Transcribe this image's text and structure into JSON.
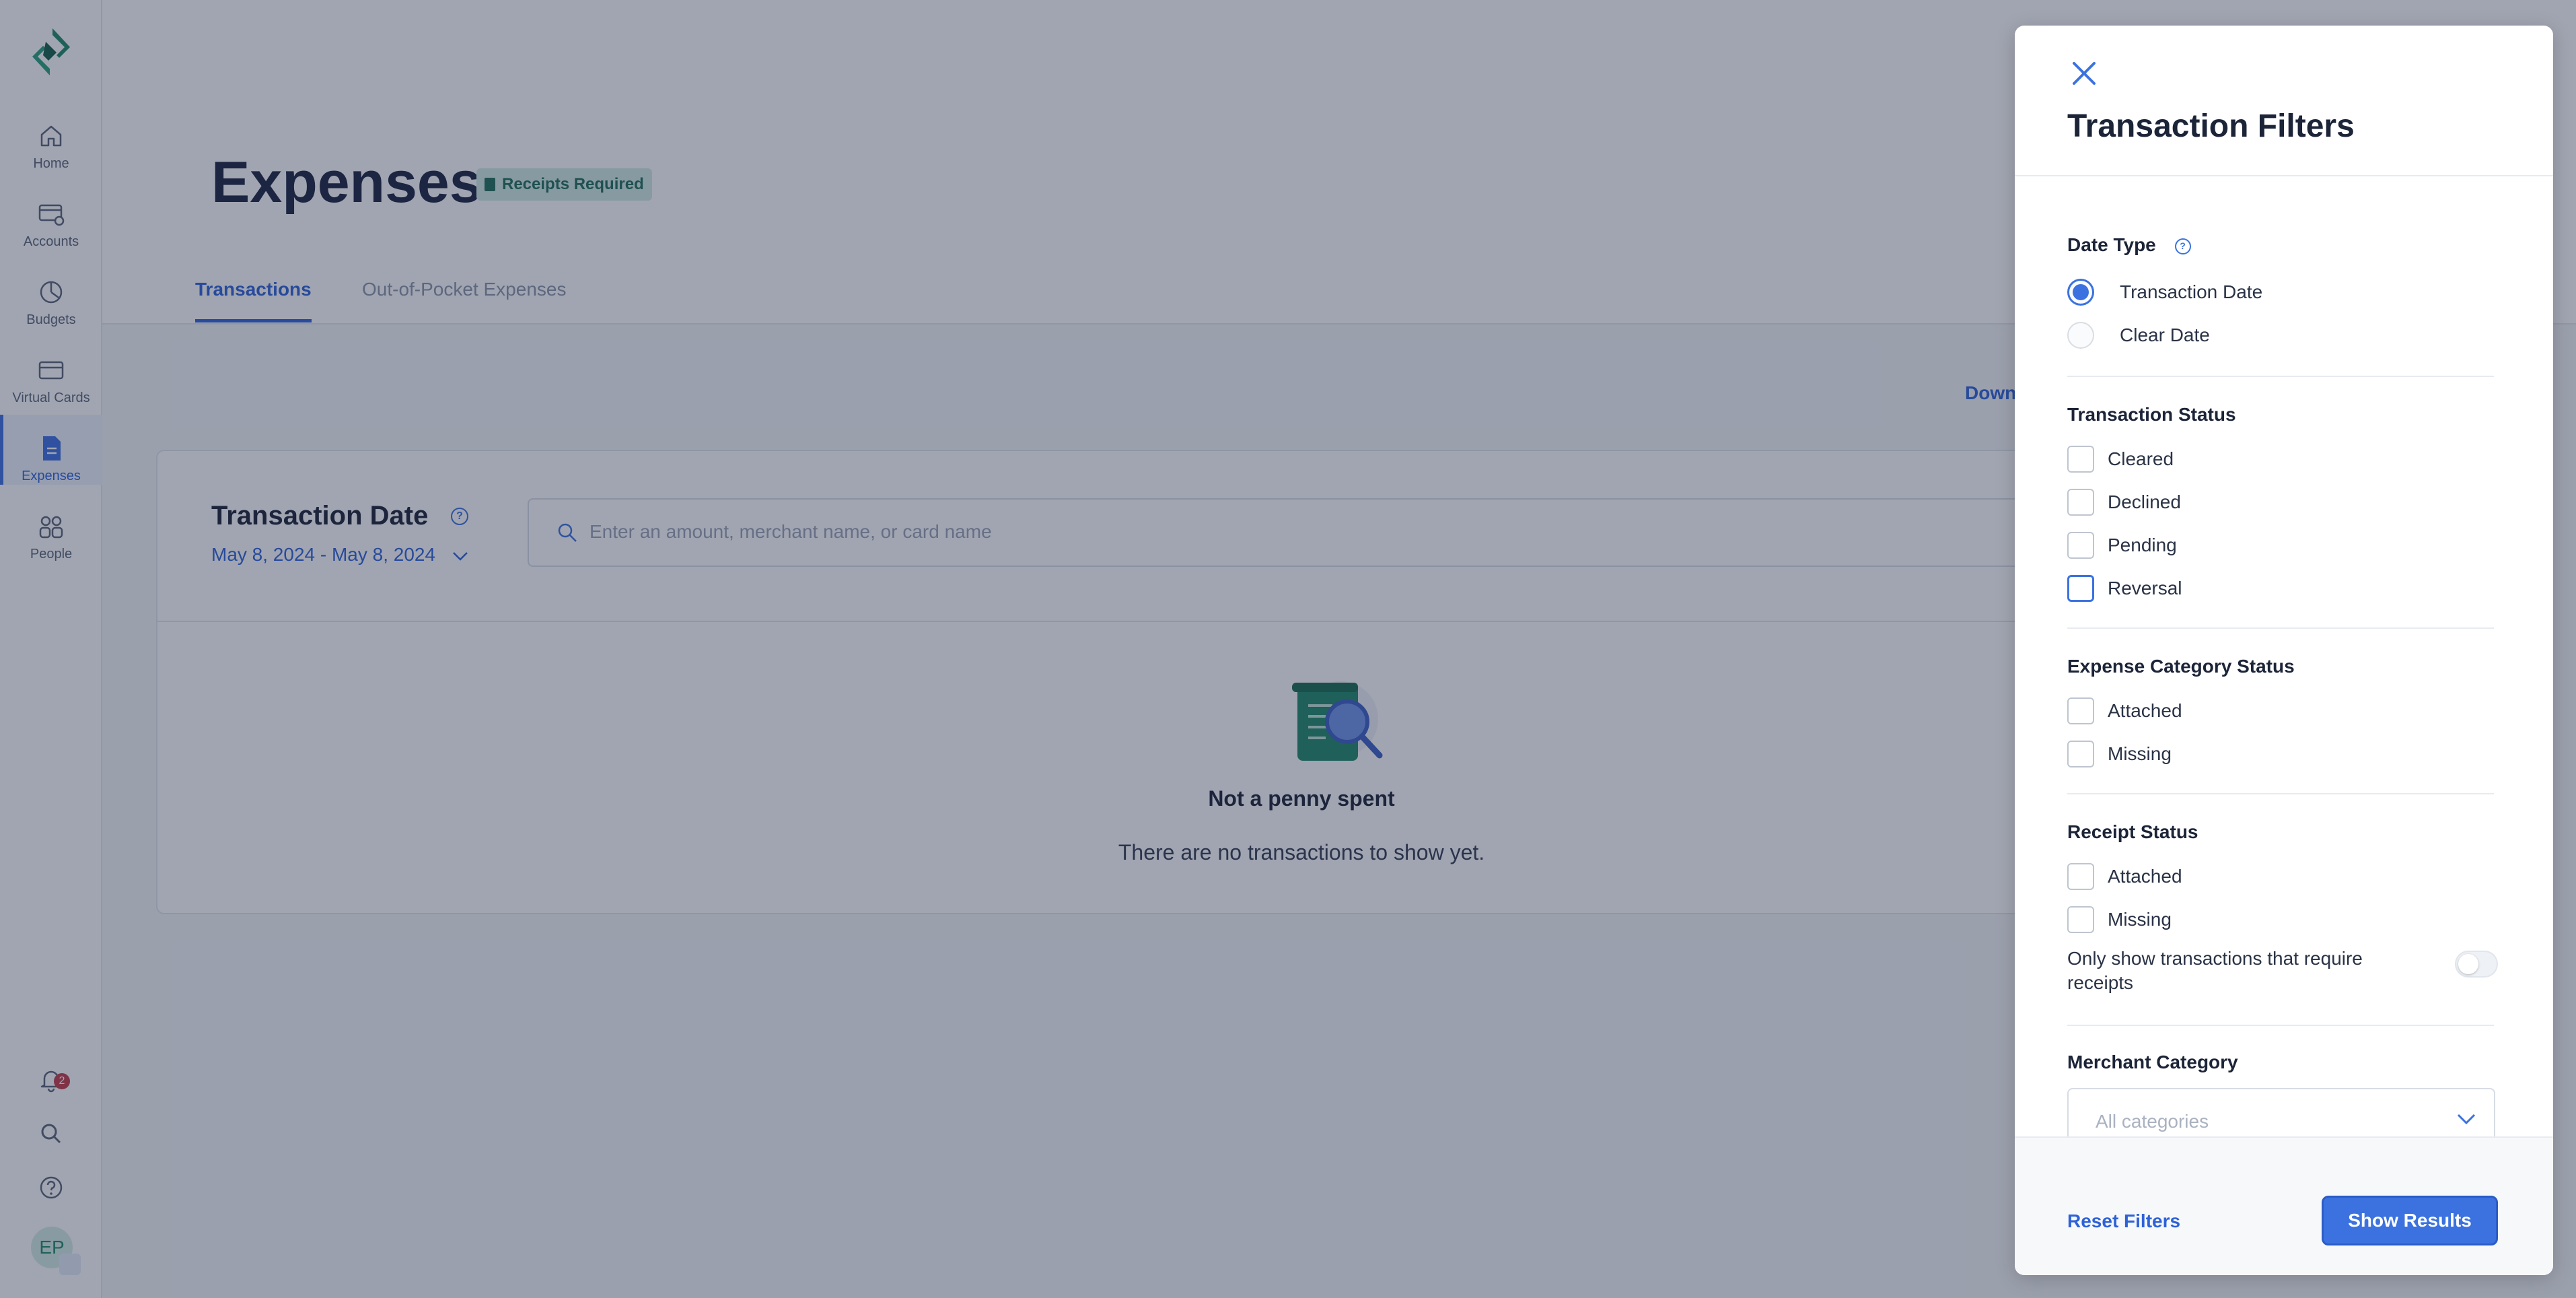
{
  "nav": {
    "items": [
      {
        "label": "Home",
        "icon": "home-icon"
      },
      {
        "label": "Accounts",
        "icon": "accounts-icon"
      },
      {
        "label": "Budgets",
        "icon": "budgets-icon"
      },
      {
        "label": "Virtual Cards",
        "icon": "card-icon"
      },
      {
        "label": "Expenses",
        "icon": "expenses-icon"
      },
      {
        "label": "People",
        "icon": "people-icon"
      }
    ],
    "notification_count": "2",
    "avatar_initials": "EP"
  },
  "page": {
    "title": "Expenses",
    "badge": "Receipts Required",
    "tabs": [
      {
        "label": "Transactions"
      },
      {
        "label": "Out-of-Pocket Expenses"
      }
    ],
    "download_label": "Down"
  },
  "transactions": {
    "date_title": "Transaction Date",
    "date_range": "May 8, 2024 - May 8, 2024",
    "search_placeholder": "Enter an amount, merchant name, or card name",
    "empty_title": "Not a penny spent",
    "empty_subtitle": "There are no transactions to show yet."
  },
  "filters": {
    "title": "Transaction Filters",
    "date_type": {
      "title": "Date Type",
      "options": [
        {
          "label": "Transaction Date",
          "selected": true
        },
        {
          "label": "Clear Date",
          "selected": false
        }
      ]
    },
    "transaction_status": {
      "title": "Transaction Status",
      "options": [
        {
          "label": "Cleared"
        },
        {
          "label": "Declined"
        },
        {
          "label": "Pending"
        },
        {
          "label": "Reversal"
        }
      ]
    },
    "expense_category_status": {
      "title": "Expense Category Status",
      "options": [
        {
          "label": "Attached"
        },
        {
          "label": "Missing"
        }
      ]
    },
    "receipt_status": {
      "title": "Receipt Status",
      "options": [
        {
          "label": "Attached"
        },
        {
          "label": "Missing"
        }
      ]
    },
    "receipts_toggle_label": "Only show transactions that require receipts",
    "merchant_category": {
      "title": "Merchant Category",
      "placeholder": "All categories"
    },
    "reset_label": "Reset Filters",
    "show_label": "Show Results"
  },
  "colors": {
    "accent": "#3b72e0",
    "brand_green": "#1f8a6a",
    "badge_bg": "#d3ede6"
  }
}
